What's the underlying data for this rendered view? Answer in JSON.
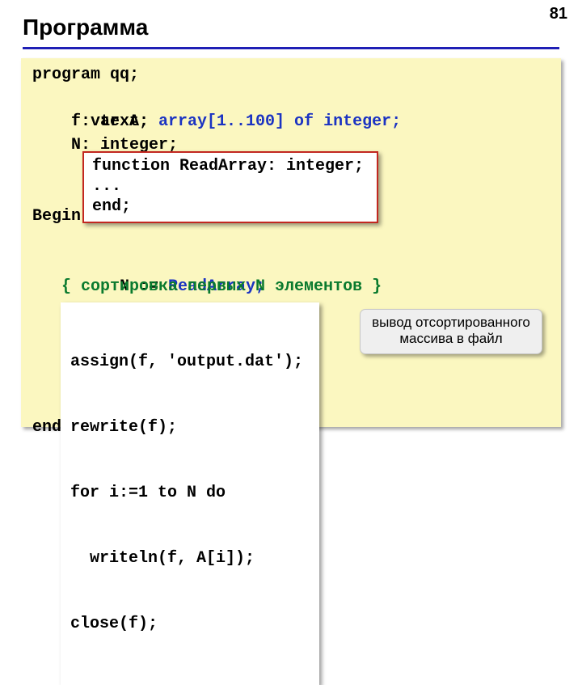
{
  "page_number": "81",
  "title": "Программа",
  "code": {
    "l1": "program qq;",
    "l2_pre": "var A: ",
    "l2_blue": "array[1..100] of integer;",
    "l3": "    f: text;",
    "l4": "    N: integer;",
    "begin": "Begin",
    "l7_pre": "   N := ",
    "l7_blue": "ReadArray;",
    "comment": "   { сортировка первых N элементов }",
    "end": "end.",
    "func_l1": "function ReadArray: integer;",
    "func_l2": "...",
    "func_l3": "end;",
    "assign_l1": "assign(f, 'output.dat');",
    "assign_l2": "rewrite(f);",
    "assign_l3": "for i:=1 to N do ",
    "assign_l4": "  writeln(f, A[i]);",
    "assign_l5": "close(f);"
  },
  "callout": {
    "line1": "вывод отсортированного",
    "line2": "массива в файл"
  }
}
